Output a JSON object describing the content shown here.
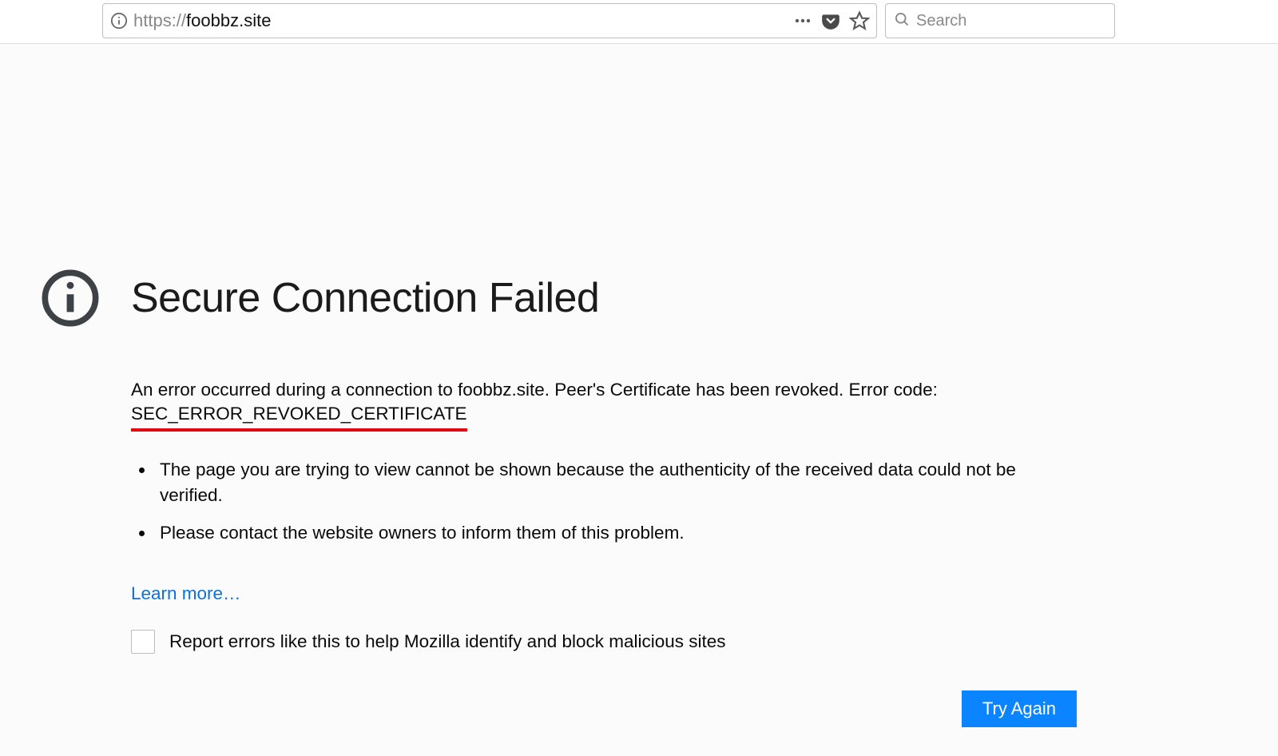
{
  "toolbar": {
    "url_scheme": "https://",
    "url_domain": "foobbz.site",
    "search_placeholder": "Search"
  },
  "error": {
    "title": "Secure Connection Failed",
    "message_prefix": "An error occurred during a connection to foobbz.site. Peer's Certificate has been revoked. Error code: ",
    "error_code": "SEC_ERROR_REVOKED_CERTIFICATE",
    "bullets": [
      "The page you are trying to view cannot be shown because the authenticity of the received data could not be verified.",
      "Please contact the website owners to inform them of this problem."
    ],
    "learn_more": "Learn more…",
    "report_label": "Report errors like this to help Mozilla identify and block malicious sites",
    "try_again": "Try Again"
  }
}
